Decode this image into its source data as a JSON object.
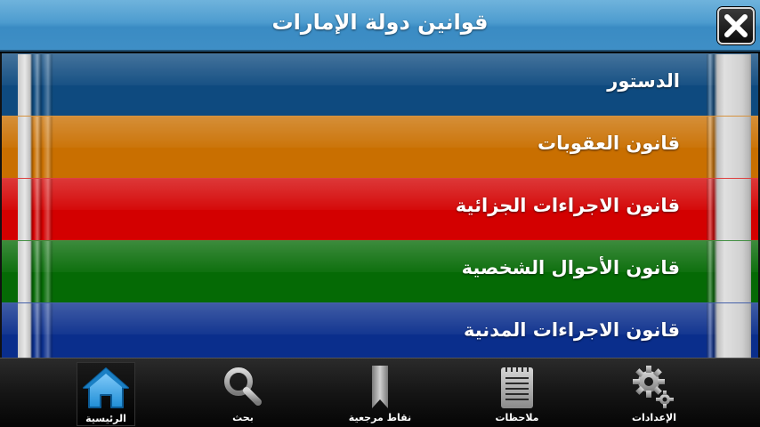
{
  "header": {
    "title": "قوانين دولة الإمارات",
    "close_icon": "close-icon"
  },
  "books": [
    {
      "label": "الدستور",
      "color": "#0e4a7f"
    },
    {
      "label": "قانون العقوبات",
      "color": "#c96f00"
    },
    {
      "label": "قانون الاجراءات الجزائية",
      "color": "#d30000"
    },
    {
      "label": "قانون الأحوال الشخصية",
      "color": "#056a05"
    },
    {
      "label": "قانون الاجراءات المدنية",
      "color": "#0a2e8c"
    }
  ],
  "tabs": [
    {
      "label": "الرئيسية",
      "icon": "home-icon",
      "active": true
    },
    {
      "label": "بحث",
      "icon": "search-icon"
    },
    {
      "label": "نقاط مرجعية",
      "icon": "bookmark-icon"
    },
    {
      "label": "ملاحظات",
      "icon": "notes-icon"
    },
    {
      "label": "الإعدادات",
      "icon": "settings-icon"
    }
  ]
}
